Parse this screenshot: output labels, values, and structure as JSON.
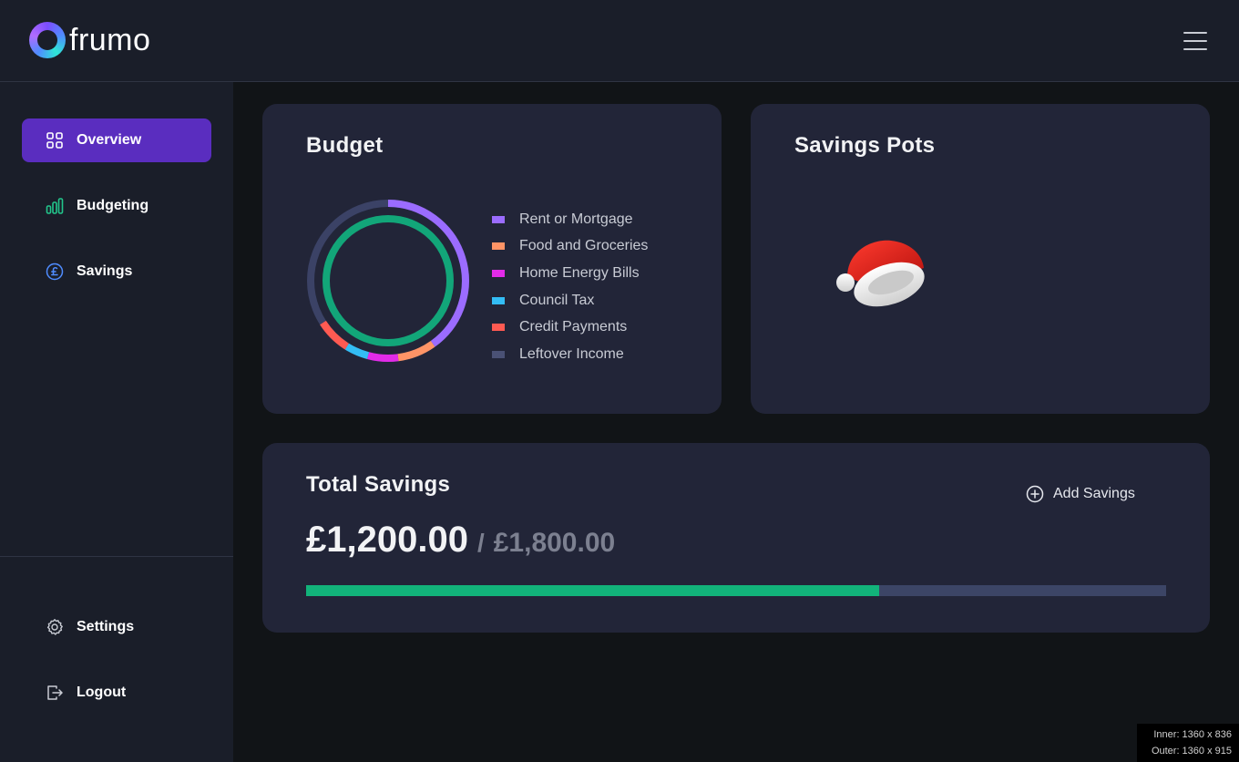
{
  "app": {
    "name": "frumo"
  },
  "header": {
    "menu_icon": "hamburger-menu-icon"
  },
  "sidebar": {
    "items": [
      {
        "label": "Overview",
        "icon": "grid-icon",
        "active": true
      },
      {
        "label": "Budgeting",
        "icon": "bar-chart-icon",
        "active": false
      },
      {
        "label": "Savings",
        "icon": "pound-coin-icon",
        "active": false
      }
    ],
    "bottom_items": [
      {
        "label": "Settings",
        "icon": "gear-icon"
      },
      {
        "label": "Logout",
        "icon": "logout-icon"
      }
    ]
  },
  "budget": {
    "title": "Budget",
    "legend": [
      {
        "label": "Rent or Mortgage",
        "color": "#9b6cff"
      },
      {
        "label": "Food and Groceries",
        "color": "#ff9466"
      },
      {
        "label": "Home Energy Bills",
        "color": "#e22be8"
      },
      {
        "label": "Council Tax",
        "color": "#33bdf5"
      },
      {
        "label": "Credit Payments",
        "color": "#ff5a52"
      },
      {
        "label": "Leftover Income",
        "color": "#4a5175"
      }
    ]
  },
  "savings_pots": {
    "title": "Savings Pots",
    "image": "santa-hat-image"
  },
  "total_savings": {
    "title": "Total Savings",
    "current": "£1,200.00",
    "separator": "/",
    "target": "£1,800.00",
    "add_label": "Add Savings",
    "progress_fraction": 0.6667
  },
  "viewport_badge": {
    "inner": "Inner: 1360 x 836",
    "outer": "Outer: 1360 x 915"
  },
  "colors": {
    "accent": "#5a2dbf",
    "progress": "#12b37a",
    "card": "#222538",
    "sidebar": "#1a1e29"
  }
}
